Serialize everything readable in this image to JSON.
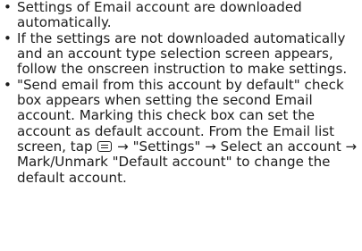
{
  "bullet_symbol": "•",
  "notes": [
    {
      "text": "Settings of Email account are downloaded automatically."
    },
    {
      "text": "If the settings are not downloaded automatically and an account type selection screen appears, follow the onscreen instruction to make settings."
    },
    {
      "text_before_icon": "\"Send email from this account by default\" check box appears when setting the second Email account. Marking this check box can set the account as default account. From the Email list screen, tap",
      "icon": "menu-key-icon",
      "text_after_icon": "→ \"Settings\" → Select an account → Mark/Unmark \"Default account\" to change the default account."
    }
  ]
}
